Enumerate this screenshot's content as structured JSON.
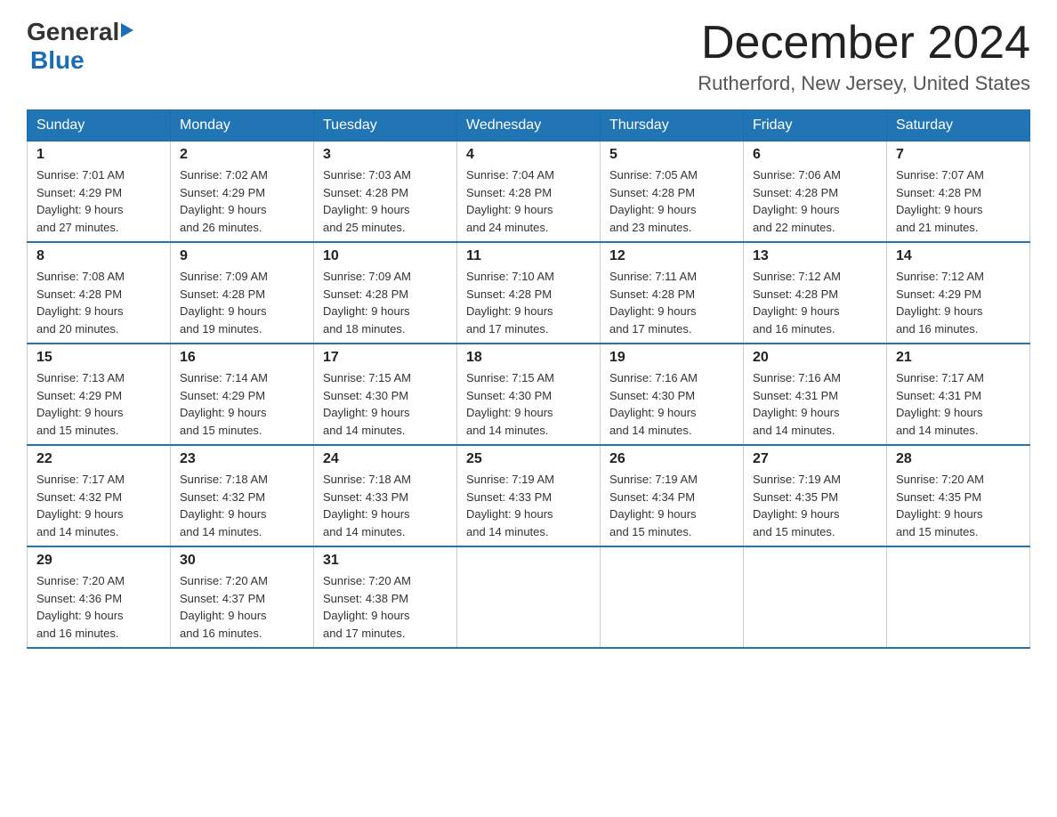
{
  "header": {
    "logo_general": "General",
    "logo_blue": "Blue",
    "title": "December 2024",
    "subtitle": "Rutherford, New Jersey, United States"
  },
  "days_of_week": [
    "Sunday",
    "Monday",
    "Tuesday",
    "Wednesday",
    "Thursday",
    "Friday",
    "Saturday"
  ],
  "weeks": [
    [
      {
        "day": "1",
        "sunrise": "7:01 AM",
        "sunset": "4:29 PM",
        "daylight": "9 hours and 27 minutes."
      },
      {
        "day": "2",
        "sunrise": "7:02 AM",
        "sunset": "4:29 PM",
        "daylight": "9 hours and 26 minutes."
      },
      {
        "day": "3",
        "sunrise": "7:03 AM",
        "sunset": "4:28 PM",
        "daylight": "9 hours and 25 minutes."
      },
      {
        "day": "4",
        "sunrise": "7:04 AM",
        "sunset": "4:28 PM",
        "daylight": "9 hours and 24 minutes."
      },
      {
        "day": "5",
        "sunrise": "7:05 AM",
        "sunset": "4:28 PM",
        "daylight": "9 hours and 23 minutes."
      },
      {
        "day": "6",
        "sunrise": "7:06 AM",
        "sunset": "4:28 PM",
        "daylight": "9 hours and 22 minutes."
      },
      {
        "day": "7",
        "sunrise": "7:07 AM",
        "sunset": "4:28 PM",
        "daylight": "9 hours and 21 minutes."
      }
    ],
    [
      {
        "day": "8",
        "sunrise": "7:08 AM",
        "sunset": "4:28 PM",
        "daylight": "9 hours and 20 minutes."
      },
      {
        "day": "9",
        "sunrise": "7:09 AM",
        "sunset": "4:28 PM",
        "daylight": "9 hours and 19 minutes."
      },
      {
        "day": "10",
        "sunrise": "7:09 AM",
        "sunset": "4:28 PM",
        "daylight": "9 hours and 18 minutes."
      },
      {
        "day": "11",
        "sunrise": "7:10 AM",
        "sunset": "4:28 PM",
        "daylight": "9 hours and 17 minutes."
      },
      {
        "day": "12",
        "sunrise": "7:11 AM",
        "sunset": "4:28 PM",
        "daylight": "9 hours and 17 minutes."
      },
      {
        "day": "13",
        "sunrise": "7:12 AM",
        "sunset": "4:28 PM",
        "daylight": "9 hours and 16 minutes."
      },
      {
        "day": "14",
        "sunrise": "7:12 AM",
        "sunset": "4:29 PM",
        "daylight": "9 hours and 16 minutes."
      }
    ],
    [
      {
        "day": "15",
        "sunrise": "7:13 AM",
        "sunset": "4:29 PM",
        "daylight": "9 hours and 15 minutes."
      },
      {
        "day": "16",
        "sunrise": "7:14 AM",
        "sunset": "4:29 PM",
        "daylight": "9 hours and 15 minutes."
      },
      {
        "day": "17",
        "sunrise": "7:15 AM",
        "sunset": "4:30 PM",
        "daylight": "9 hours and 14 minutes."
      },
      {
        "day": "18",
        "sunrise": "7:15 AM",
        "sunset": "4:30 PM",
        "daylight": "9 hours and 14 minutes."
      },
      {
        "day": "19",
        "sunrise": "7:16 AM",
        "sunset": "4:30 PM",
        "daylight": "9 hours and 14 minutes."
      },
      {
        "day": "20",
        "sunrise": "7:16 AM",
        "sunset": "4:31 PM",
        "daylight": "9 hours and 14 minutes."
      },
      {
        "day": "21",
        "sunrise": "7:17 AM",
        "sunset": "4:31 PM",
        "daylight": "9 hours and 14 minutes."
      }
    ],
    [
      {
        "day": "22",
        "sunrise": "7:17 AM",
        "sunset": "4:32 PM",
        "daylight": "9 hours and 14 minutes."
      },
      {
        "day": "23",
        "sunrise": "7:18 AM",
        "sunset": "4:32 PM",
        "daylight": "9 hours and 14 minutes."
      },
      {
        "day": "24",
        "sunrise": "7:18 AM",
        "sunset": "4:33 PM",
        "daylight": "9 hours and 14 minutes."
      },
      {
        "day": "25",
        "sunrise": "7:19 AM",
        "sunset": "4:33 PM",
        "daylight": "9 hours and 14 minutes."
      },
      {
        "day": "26",
        "sunrise": "7:19 AM",
        "sunset": "4:34 PM",
        "daylight": "9 hours and 15 minutes."
      },
      {
        "day": "27",
        "sunrise": "7:19 AM",
        "sunset": "4:35 PM",
        "daylight": "9 hours and 15 minutes."
      },
      {
        "day": "28",
        "sunrise": "7:20 AM",
        "sunset": "4:35 PM",
        "daylight": "9 hours and 15 minutes."
      }
    ],
    [
      {
        "day": "29",
        "sunrise": "7:20 AM",
        "sunset": "4:36 PM",
        "daylight": "9 hours and 16 minutes."
      },
      {
        "day": "30",
        "sunrise": "7:20 AM",
        "sunset": "4:37 PM",
        "daylight": "9 hours and 16 minutes."
      },
      {
        "day": "31",
        "sunrise": "7:20 AM",
        "sunset": "4:38 PM",
        "daylight": "9 hours and 17 minutes."
      },
      null,
      null,
      null,
      null
    ]
  ]
}
